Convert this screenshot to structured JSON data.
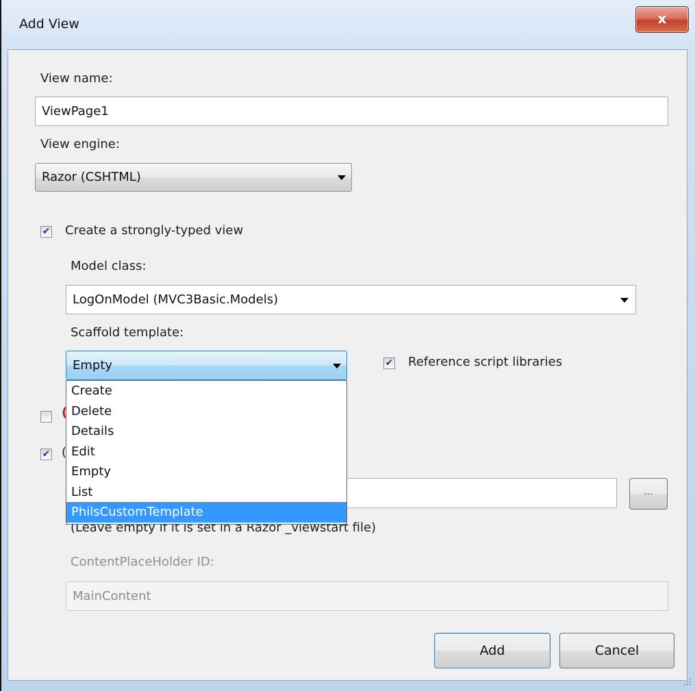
{
  "window": {
    "title": "Add View",
    "close_label": "x"
  },
  "view_name": {
    "label": "View name:",
    "value": "ViewPage1"
  },
  "view_engine": {
    "label": "View engine:",
    "value": "Razor (CSHTML)"
  },
  "strongly_typed": {
    "label": "Create a strongly-typed view",
    "checked": true
  },
  "model_class": {
    "label": "Model class:",
    "value": "LogOnModel (MVC3Basic.Models)"
  },
  "scaffold": {
    "label": "Scaffold template:",
    "value": "Empty",
    "options": [
      "Create",
      "Delete",
      "Details",
      "Edit",
      "Empty",
      "List",
      "PhilsCustomTemplate"
    ],
    "highlighted": "PhilsCustomTemplate"
  },
  "reference_scripts": {
    "label": "Reference script libraries",
    "checked": true
  },
  "partial_view": {
    "checked": false
  },
  "use_layout": {
    "checked": true
  },
  "layout_path": {
    "value": "",
    "hint": "(Leave empty if it is set in a Razor _viewstart file)",
    "browse_label": "..."
  },
  "content_placeholder": {
    "label": "ContentPlaceHolder ID:",
    "value": "MainContent"
  },
  "buttons": {
    "add": "Add",
    "cancel": "Cancel"
  }
}
